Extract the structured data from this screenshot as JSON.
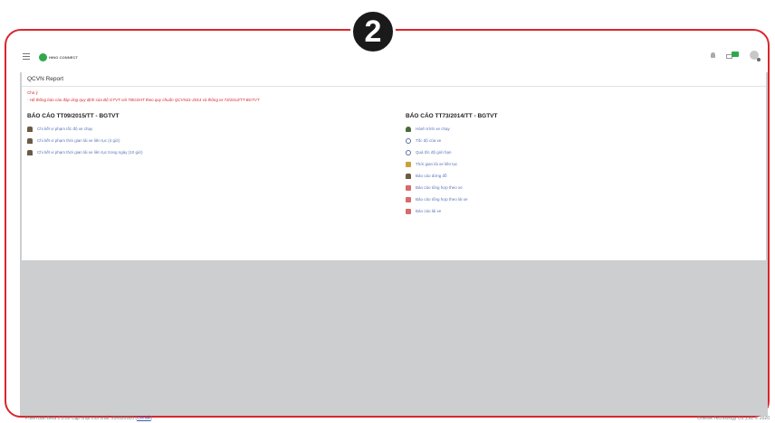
{
  "badge": "2",
  "header": {
    "logo_text": "HINO CONNECT"
  },
  "page_title": "QCVN Report",
  "note": {
    "title": "Chú ý",
    "text": "- Hệ thống báo cáo đáp ứng quy định của Bộ GTVT với TBGSHT theo quy chuẩn QCVN31-2014 và thông tư 73/2014/TT-BGTVT"
  },
  "left_section": {
    "title": "BÁO CÁO TT09/2015/TT - BGTVT",
    "items": [
      {
        "label": "Chi tiết vi phạm tốc độ xe chạy",
        "icon": "person-icon"
      },
      {
        "label": "Chi tiết vi phạm thời gian lái xe liên tục (4 giờ)",
        "icon": "person-icon"
      },
      {
        "label": "Chi tiết vi phạm thời gian lái xe liên tục trong ngày (10 giờ)",
        "icon": "person-icon"
      }
    ]
  },
  "right_section": {
    "title": "BÁO CÁO TT73/2014/TT - BGTVT",
    "items": [
      {
        "label": "Hành trình xe chạy",
        "icon": "car-icon"
      },
      {
        "label": "Tốc độ của xe",
        "icon": "clock-icon"
      },
      {
        "label": "Quá tốc độ giới hạn",
        "icon": "clock-icon"
      },
      {
        "label": "Thời gian lái xe liên tục",
        "icon": "driver-icon"
      },
      {
        "label": "Báo cáo dừng đỗ",
        "icon": "person-icon"
      },
      {
        "label": "Báo cáo tổng hợp theo xe",
        "icon": "report-icon"
      },
      {
        "label": "Báo cáo tổng hợp theo lái xe",
        "icon": "report-icon"
      },
      {
        "label": "Báo cáo lái xe",
        "icon": "report-icon"
      }
    ]
  },
  "footer": {
    "version": "Phiên bản Beta 2.0.00 Cập nhật mới nhất: 20/03/2020 (",
    "detail_link": "Chi tiết",
    "version_end": ")",
    "copyright": "Onelink Technology Co.,Ltd. © 2020"
  },
  "colors": {
    "frame_border": "#d9262c",
    "brand_green": "#2fa84f",
    "link": "#5a75b8",
    "warning": "#d9262c"
  }
}
